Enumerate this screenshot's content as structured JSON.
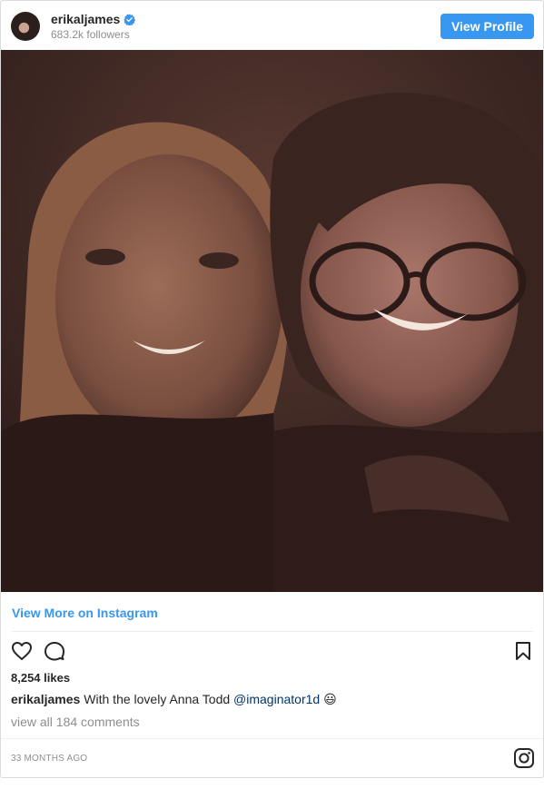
{
  "header": {
    "username": "erikaljames",
    "followers": "683.2k followers",
    "view_profile_label": "View Profile"
  },
  "post": {
    "view_more_label": "View More on Instagram",
    "likes": "8,254 likes",
    "caption_user": "erikaljames",
    "caption_text": "With the lovely Anna Todd",
    "caption_mention": "@imaginator1d",
    "caption_emoji": "😃",
    "comments_label": "view all 184 comments",
    "timestamp": "33 MONTHS AGO"
  },
  "icons": {
    "like": "heart-icon",
    "comment": "comment-icon",
    "save": "bookmark-icon",
    "brand": "instagram-icon",
    "verified": "verified-badge-icon"
  },
  "colors": {
    "accent": "#3897f0",
    "mention": "#003569",
    "muted": "#8e8e8e",
    "text": "#262626"
  }
}
